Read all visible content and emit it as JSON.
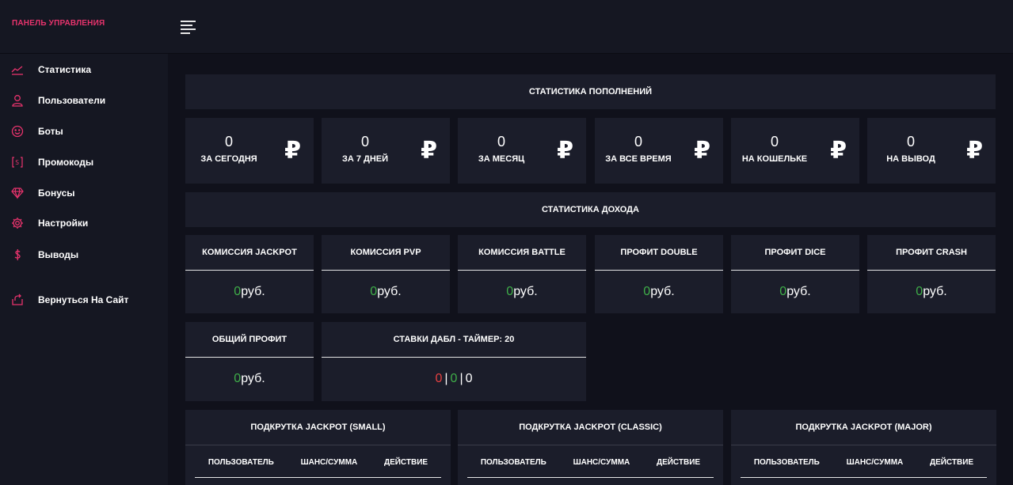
{
  "header": {
    "brand": "ПАНЕЛЬ УПРАВЛЕНИЯ",
    "menu_icon": "menu-lines-icon"
  },
  "sidebar": {
    "items": [
      {
        "label": "Статистика",
        "icon": "chart-line-icon"
      },
      {
        "label": "Пользователи",
        "icon": "user-icon"
      },
      {
        "label": "Боты",
        "icon": "smile-icon"
      },
      {
        "label": "Промокоды",
        "icon": "promo-code-icon"
      },
      {
        "label": "Бонусы",
        "icon": "diamond-icon"
      },
      {
        "label": "Настройки",
        "icon": "gear-icon"
      },
      {
        "label": "Выводы",
        "icon": "dollar-icon"
      },
      {
        "label": "Вернуться На Сайт",
        "icon": "return-icon"
      }
    ]
  },
  "deposits": {
    "title": "СТАТИСТИКА ПОПОЛНЕНИЙ",
    "currency_symbol": "₽",
    "cards": [
      {
        "value": "0",
        "label": "ЗА СЕГОДНЯ"
      },
      {
        "value": "0",
        "label": "ЗА 7 ДНЕЙ"
      },
      {
        "value": "0",
        "label": "ЗА МЕСЯЦ"
      },
      {
        "value": "0",
        "label": "ЗА ВСЕ ВРЕМЯ"
      },
      {
        "value": "0",
        "label": "НА КОШЕЛЬКЕ"
      },
      {
        "value": "0",
        "label": "НА ВЫВОД"
      }
    ]
  },
  "income": {
    "title": "СТАТИСТИКА ДОХОДА",
    "unit": "руб.",
    "cards": [
      {
        "label": "КОМИССИЯ JACKPOT",
        "value": "0"
      },
      {
        "label": "КОМИССИЯ PVP",
        "value": "0"
      },
      {
        "label": "КОМИССИЯ BATTLE",
        "value": "0"
      },
      {
        "label": "ПРОФИТ DOUBLE",
        "value": "0"
      },
      {
        "label": "ПРОФИТ DICE",
        "value": "0"
      },
      {
        "label": "ПРОФИТ CRASH",
        "value": "0"
      }
    ],
    "total": {
      "label": "ОБЩИЙ ПРОФИТ",
      "value": "0"
    },
    "double_bets": {
      "label": "СТАВКИ ДАБЛ - ТАЙМЕР: 20",
      "red": "0",
      "green": "0",
      "black": "0",
      "separator": "|"
    }
  },
  "jackpot": {
    "columns": [
      "ПОЛЬЗОВАТЕЛЬ",
      "ШАНС/СУММА",
      "ДЕЙСТВИЕ"
    ],
    "panels": [
      {
        "title": "ПОДКРУТКА JACKPOT (SMALL)"
      },
      {
        "title": "ПОДКРУТКА JACKPOT (CLASSIC)"
      },
      {
        "title": "ПОДКРУТКА JACKPOT (MAJOR)"
      }
    ]
  }
}
